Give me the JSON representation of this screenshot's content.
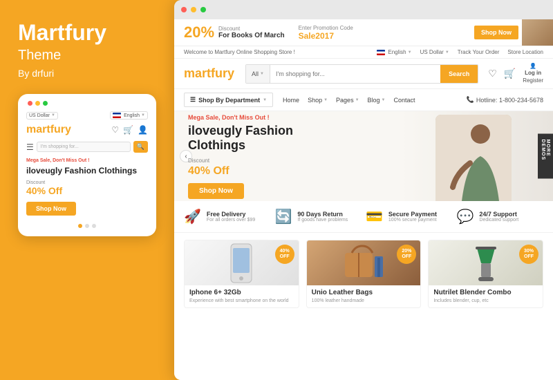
{
  "brand": {
    "name": "Martfury",
    "subtitle": "Theme",
    "by": "By drfuri"
  },
  "mobile": {
    "currency": "US Dollar",
    "language": "English",
    "logo": "mart",
    "logo_accent": "fury",
    "search_placeholder": "I'm shopping for...",
    "promo_text": "Mega Sale, Don't Miss Out !",
    "hero_title": "iloveugly Fashion Clothings",
    "discount_label": "Discount",
    "discount_value": "40% Off",
    "shop_btn": "Shop Now"
  },
  "browser": {
    "promo_banner": {
      "percent": "20%",
      "discount_label": "Discount",
      "book_text": "For Books Of March",
      "enter_label": "Enter Promotion Code",
      "code": "Sale2017",
      "shop_btn": "Shop Now"
    },
    "utility_bar": {
      "welcome": "Welcome to Martfury Online Shopping Store !",
      "language": "English",
      "currency": "US Dollar",
      "track_order": "Track Your Order",
      "store_location": "Store Location"
    },
    "search": {
      "category": "All",
      "placeholder": "I'm shopping for...",
      "btn": "Search"
    },
    "logo": "mart",
    "logo_accent": "fury",
    "login_label": "Log in",
    "register_label": "Register",
    "category_nav": {
      "shop_dept": "Shop By Department",
      "home": "Home",
      "shop": "Shop",
      "pages": "Pages",
      "blog": "Blog",
      "contact": "Contact",
      "hotline": "Hotline: 1-800-234-5678"
    },
    "hero": {
      "mega_sale": "Mega Sale, Don't Miss Out !",
      "title_line1": "iloveugly Fashion",
      "title_line2": "Clothings",
      "discount_label": "Discount",
      "discount": "40% Off",
      "shop_btn": "Shop Now",
      "more_demos": "MORE DEMOS"
    },
    "features": [
      {
        "icon": "🚀",
        "title": "Free Delivery",
        "desc": "For all orders over $99"
      },
      {
        "icon": "🔄",
        "title": "90 Days Return",
        "desc": "If goods have problems"
      },
      {
        "icon": "💳",
        "title": "Secure Payment",
        "desc": "100% secure payment"
      },
      {
        "icon": "💬",
        "title": "24/7 Support",
        "desc": "Dedicated support"
      }
    ],
    "products": [
      {
        "name": "Iphone 6+ 32Gb",
        "desc": "Experience with best smartphone on the world",
        "badge": "40%\nOFF",
        "img_type": "iphone"
      },
      {
        "name": "Unio Leather Bags",
        "desc": "100% leather handmade",
        "badge": "20%\nOFF",
        "img_type": "bags"
      },
      {
        "name": "Nutrilet Blender Combo",
        "desc": "Includes blender, cup, etc",
        "badge": "30%\nOFF",
        "img_type": "blender"
      }
    ]
  }
}
